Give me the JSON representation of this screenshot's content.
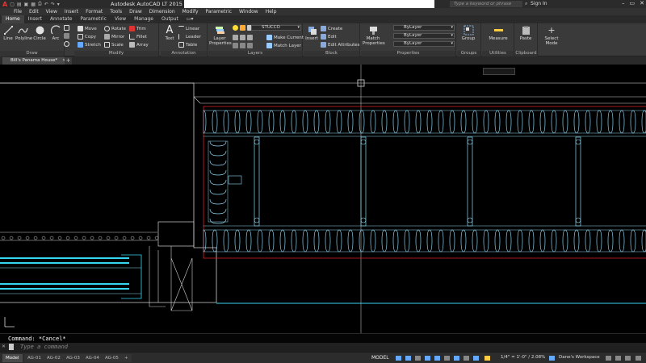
{
  "titlebar": {
    "app_title": "Autodesk AutoCAD LT 2015    C:\\Use",
    "search_placeholder": "Type a keyword or phrase",
    "signin": "Sign In",
    "minimize": "–",
    "restore": "▭",
    "close": "✕"
  },
  "menubar": {
    "items": [
      "File",
      "Edit",
      "View",
      "Insert",
      "Format",
      "Tools",
      "Draw",
      "Dimension",
      "Modify",
      "Parametric",
      "Window",
      "Help"
    ]
  },
  "ribbon_tabs": {
    "items": [
      "Home",
      "Insert",
      "Annotate",
      "Parametric",
      "View",
      "Manage",
      "Output"
    ],
    "active": "Home"
  },
  "ribbon": {
    "draw": {
      "title": "Draw",
      "line": "Line",
      "polyline": "Polyline",
      "circle": "Circle",
      "arc": "Arc"
    },
    "modify": {
      "title": "Modify",
      "move": "Move",
      "rotate": "Rotate",
      "trim": "Trim",
      "copy": "Copy",
      "mirror": "Mirror",
      "fillet": "Fillet",
      "stretch": "Stretch",
      "scale": "Scale",
      "array": "Array"
    },
    "annotation": {
      "title": "Annotation",
      "text": "Text",
      "linear": "Linear",
      "leader": "Leader",
      "table": "Table"
    },
    "layers": {
      "title": "Layers",
      "layer_properties": "Layer Properties",
      "current_layer": "STUCCO",
      "make_current": "Make Current",
      "match_layer": "Match Layer"
    },
    "block": {
      "title": "Block",
      "insert": "Insert",
      "create": "Create",
      "edit": "Edit",
      "edit_attributes": "Edit Attributes"
    },
    "properties": {
      "title": "Properties",
      "match_properties": "Match Properties",
      "color": "ByLayer",
      "linetype": "ByLayer",
      "lineweight": "ByLayer"
    },
    "groups": {
      "title": "Groups",
      "group": "Group"
    },
    "utilities": {
      "title": "Utilities",
      "measure": "Measure"
    },
    "clipboard": {
      "title": "Clipboard",
      "paste": "Paste"
    },
    "select_mode": "Select Mode"
  },
  "doc_tabs": {
    "file": "Bill's Panama House*",
    "plus": "+"
  },
  "command": {
    "history": "Command: *Cancel*",
    "placeholder": "Type a command"
  },
  "layout_tabs": [
    "Model",
    "AG-01",
    "AG-02",
    "AG-03",
    "AG-04",
    "AG-05",
    "+"
  ],
  "status": {
    "model": "MODEL",
    "scale": "1/4\" = 1'-0\" / 2.08%",
    "workspace": "Dane's Workspace"
  },
  "colors": {
    "background": "#000000",
    "ribbon": "#3a3a3a",
    "cad_cyan": "#8fd6f0",
    "cad_bright_cyan": "#36d6f0",
    "cad_red": "#e02020",
    "cad_white": "#d0d0d0"
  }
}
